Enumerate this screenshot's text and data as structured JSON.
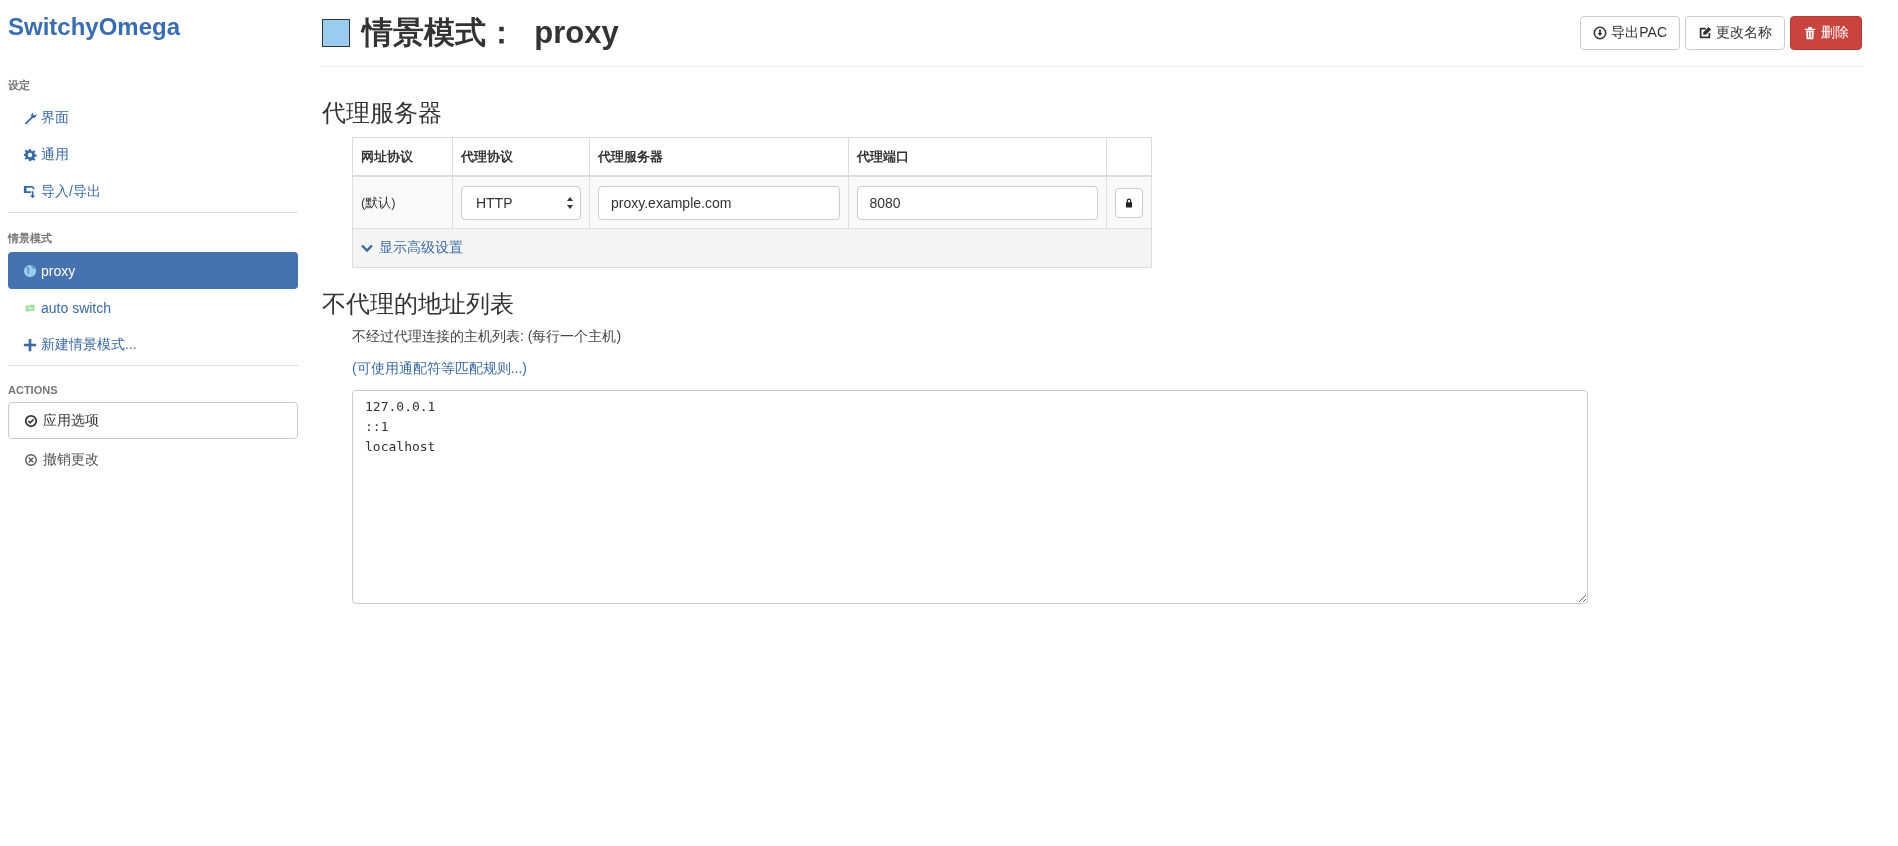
{
  "sidebar": {
    "logo": "SwitchyOmega",
    "settings_header": "设定",
    "settings_items": [
      {
        "label": "界面",
        "selected": false
      },
      {
        "label": "通用",
        "selected": false
      },
      {
        "label": "导入/导出",
        "selected": false
      }
    ],
    "profiles_header": "情景模式",
    "profiles": [
      {
        "label": "proxy",
        "color": "#99ccee",
        "selected": true
      },
      {
        "label": "auto switch",
        "color": "#99dd99",
        "selected": false
      }
    ],
    "new_profile": "新建情景模式...",
    "actions_header": "ACTIONS",
    "actions": [
      {
        "label": "应用选项",
        "kind": "primary"
      },
      {
        "label": "撤销更改",
        "kind": "plain"
      }
    ]
  },
  "header": {
    "title_prefix": "情景模式：",
    "title": "proxy",
    "color": "#99ccee",
    "buttons": [
      {
        "label": "导出PAC",
        "kind": "export"
      },
      {
        "label": "更改名称",
        "kind": "rename"
      },
      {
        "label": "删除",
        "kind": "delete"
      }
    ]
  },
  "proxy_section": {
    "title": "代理服务器",
    "columns": [
      "网址协议",
      "代理协议",
      "代理服务器",
      "代理端口"
    ],
    "rows": [
      {
        "scheme": "(默认)",
        "protocol": "HTTP",
        "server": "proxy.example.com",
        "port": "8080"
      }
    ],
    "advanced_link": "显示高级设置"
  },
  "bypass_section": {
    "title": "不代理的地址列表",
    "help": "不经过代理连接的主机列表: (每行一个主机)",
    "rules_link": "(可使用通配符等匹配规则...)",
    "list": [
      "127.0.0.1",
      "::1",
      "localhost"
    ]
  }
}
